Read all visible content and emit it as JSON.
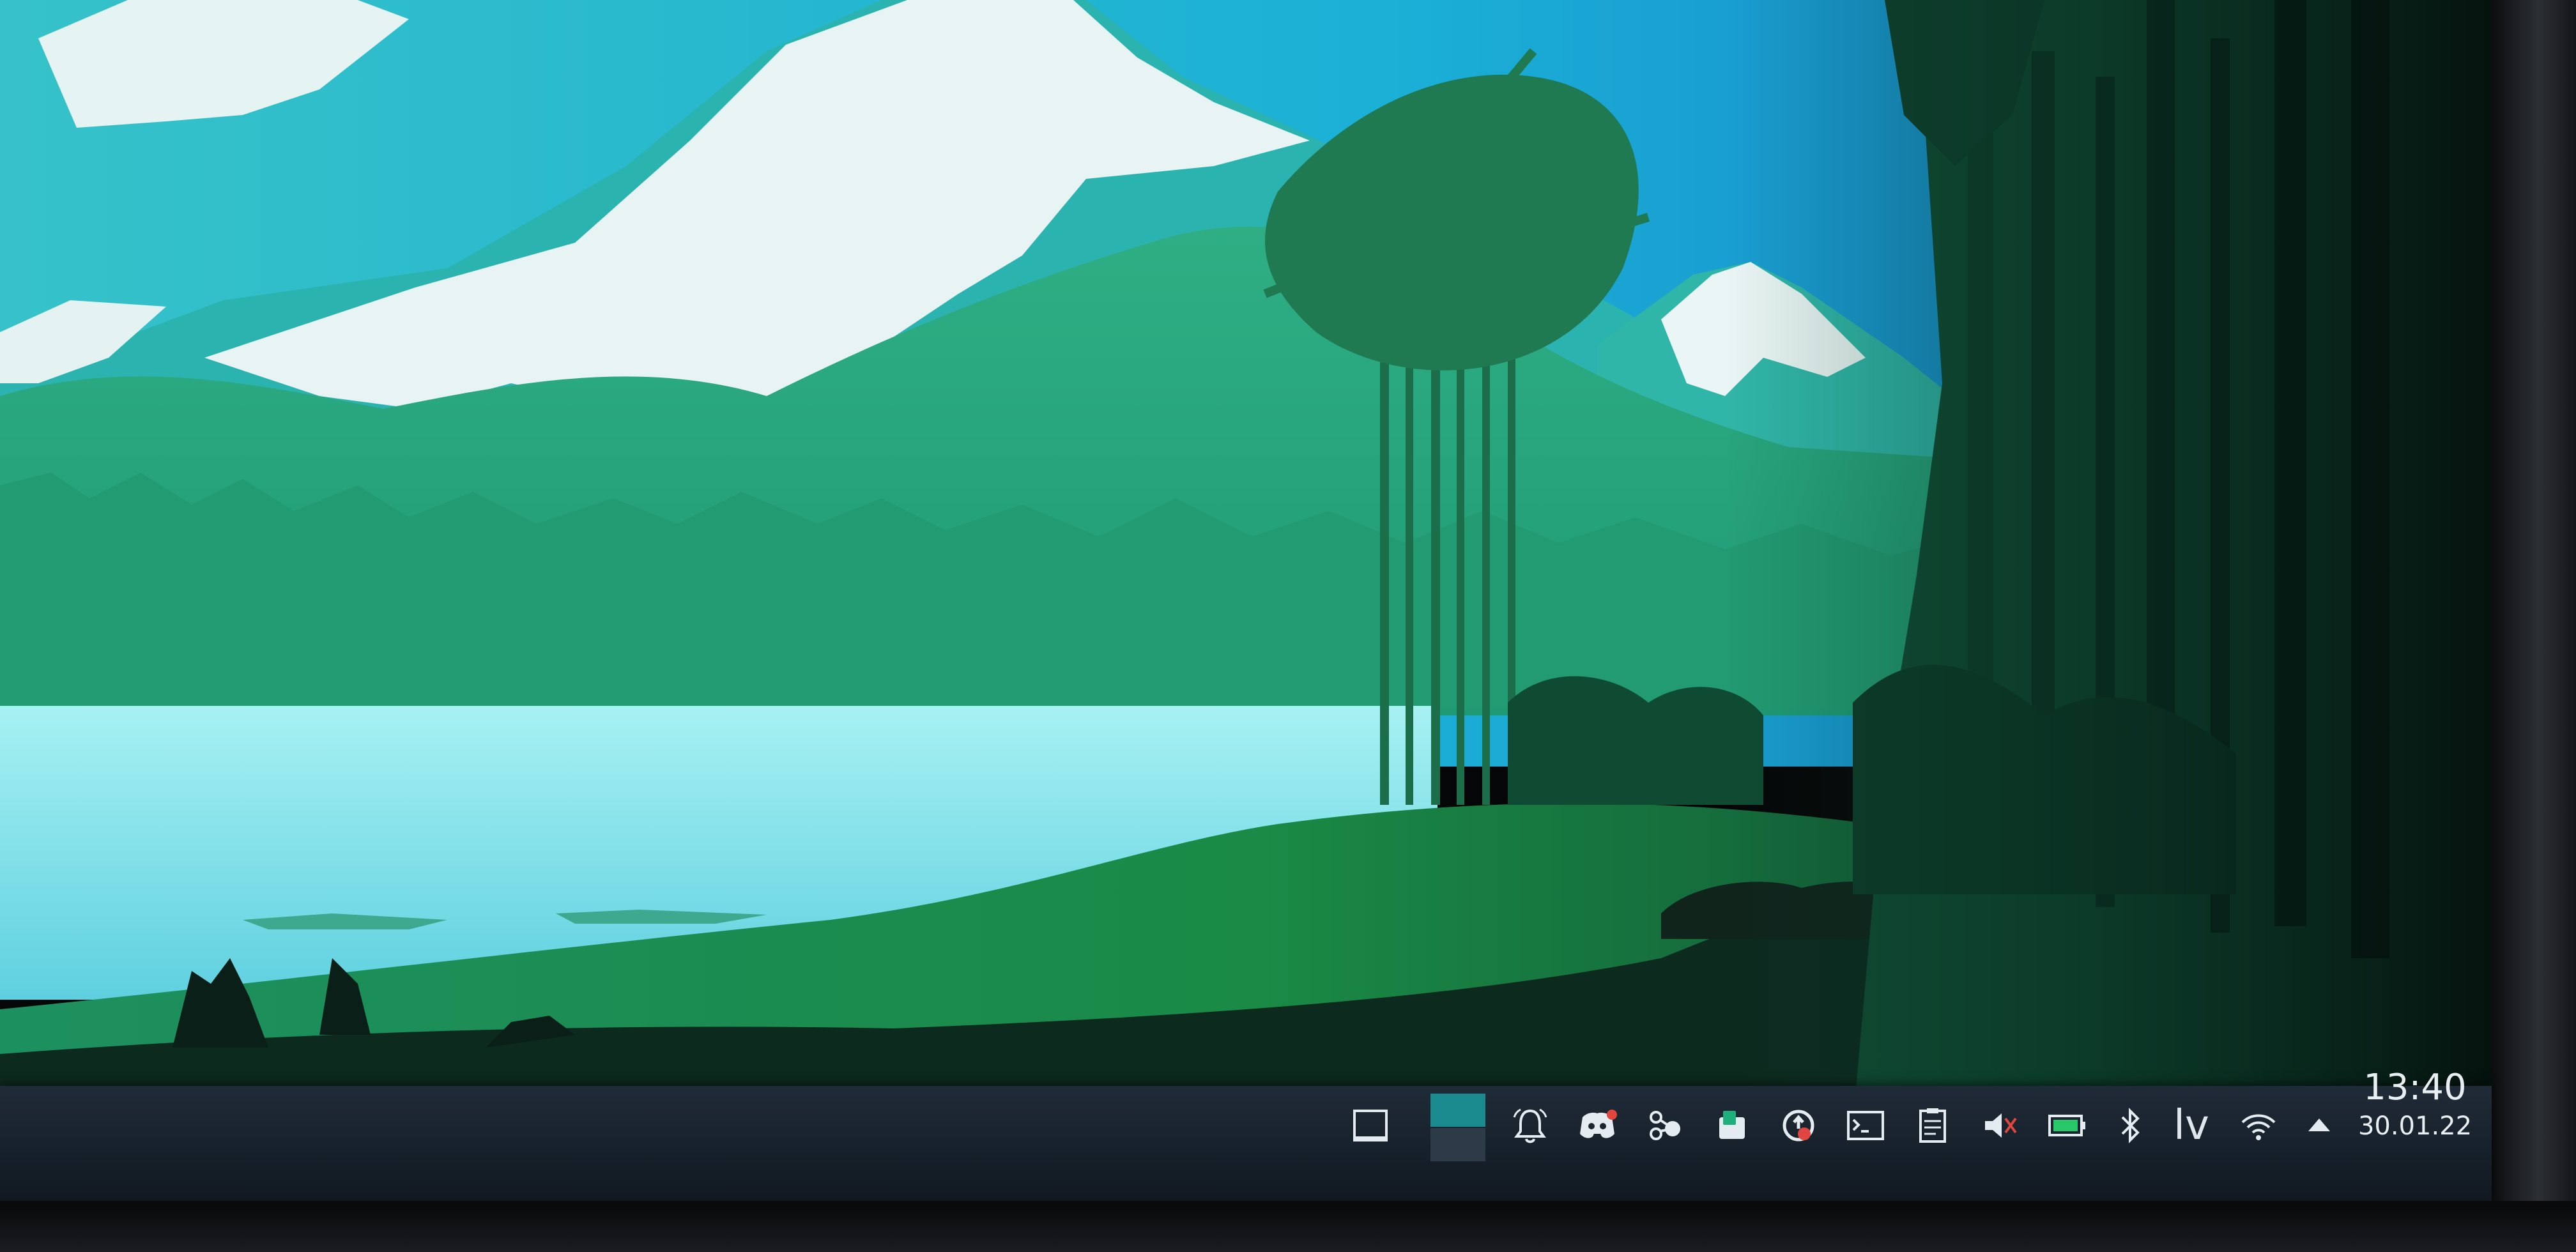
{
  "taskbar": {
    "show_desktop_icon": "show-desktop-icon",
    "pager": {
      "desktops": 2,
      "active_desktop": 1
    },
    "tray_icons": [
      "notifications-icon",
      "discord-icon",
      "kdeconnect-icon",
      "clipboard-app-icon",
      "update-notifier-icon",
      "terminal-icon",
      "clipboard-icon",
      "volume-muted-icon",
      "battery-icon",
      "bluetooth-icon",
      "keyboard-layout",
      "wifi-icon",
      "expand-tray-icon"
    ],
    "keyboard_layout": "lv",
    "clock": {
      "time": "13:40",
      "date": "30.01.22"
    }
  },
  "colors": {
    "taskbar_bg": "#1b2631",
    "accent": "#1b8a8f",
    "sky": "#2aa3dc",
    "lake": "#7fe3ea",
    "forest": "#1e8a5f"
  }
}
